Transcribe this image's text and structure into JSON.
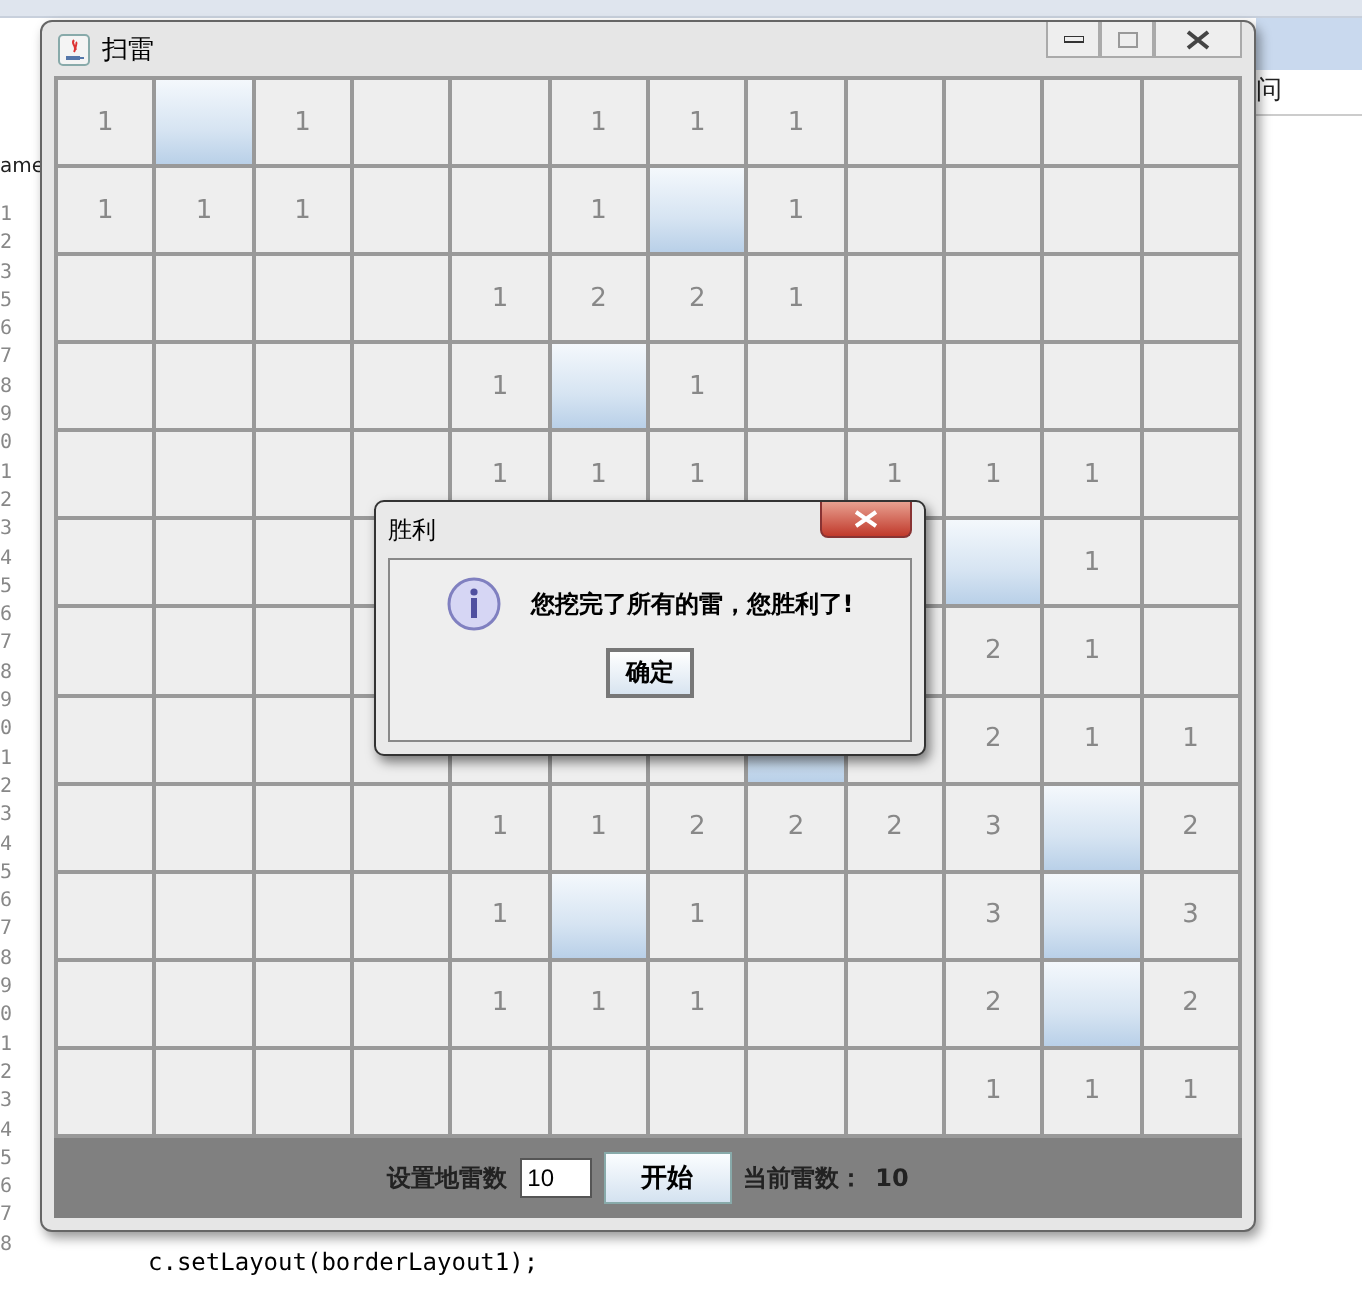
{
  "background": {
    "line_numbers": [
      "1",
      "2",
      "3",
      "5",
      "6",
      "7",
      "8",
      "9",
      "0",
      "1",
      "2",
      "3",
      "4",
      "5",
      "6",
      "7",
      "8",
      "9",
      "0",
      "1",
      "2",
      "3",
      "4",
      "5",
      "6",
      "7",
      "8",
      "9",
      "0",
      "1",
      "2",
      "3",
      "4",
      "5",
      "6",
      "7",
      "8"
    ],
    "side_text": "ame",
    "field_text": "问",
    "code_line": "c.setLayout(borderLayout1);"
  },
  "window": {
    "title": "扫雷",
    "grid": [
      [
        {
          "t": "1",
          "covered": false
        },
        {
          "covered": true
        },
        {
          "t": "1",
          "covered": false
        },
        {
          "covered": false
        },
        {
          "covered": false
        },
        {
          "t": "1",
          "covered": false
        },
        {
          "t": "1",
          "covered": false
        },
        {
          "t": "1",
          "covered": false
        },
        {
          "covered": false
        },
        {
          "covered": false
        },
        {
          "covered": false
        },
        {
          "covered": false
        }
      ],
      [
        {
          "t": "1",
          "covered": false
        },
        {
          "t": "1",
          "covered": false
        },
        {
          "t": "1",
          "covered": false
        },
        {
          "covered": false
        },
        {
          "covered": false
        },
        {
          "t": "1",
          "covered": false
        },
        {
          "covered": true
        },
        {
          "t": "1",
          "covered": false
        },
        {
          "covered": false
        },
        {
          "covered": false
        },
        {
          "covered": false
        },
        {
          "covered": false
        }
      ],
      [
        {
          "covered": false
        },
        {
          "covered": false
        },
        {
          "covered": false
        },
        {
          "covered": false
        },
        {
          "t": "1",
          "covered": false
        },
        {
          "t": "2",
          "covered": false
        },
        {
          "t": "2",
          "covered": false
        },
        {
          "t": "1",
          "covered": false
        },
        {
          "covered": false
        },
        {
          "covered": false
        },
        {
          "covered": false
        },
        {
          "covered": false
        }
      ],
      [
        {
          "covered": false
        },
        {
          "covered": false
        },
        {
          "covered": false
        },
        {
          "covered": false
        },
        {
          "t": "1",
          "covered": false
        },
        {
          "covered": true
        },
        {
          "t": "1",
          "covered": false
        },
        {
          "covered": false
        },
        {
          "covered": false
        },
        {
          "covered": false
        },
        {
          "covered": false
        },
        {
          "covered": false
        }
      ],
      [
        {
          "covered": false
        },
        {
          "covered": false
        },
        {
          "covered": false
        },
        {
          "covered": false
        },
        {
          "t": "1",
          "covered": false
        },
        {
          "t": "1",
          "covered": false
        },
        {
          "t": "1",
          "covered": false
        },
        {
          "covered": false
        },
        {
          "t": "1",
          "covered": false
        },
        {
          "t": "1",
          "covered": false
        },
        {
          "t": "1",
          "covered": false
        },
        {
          "covered": false
        }
      ],
      {
        "cells": [
          {
            "covered": false
          },
          {
            "covered": false
          },
          {
            "covered": false
          },
          {
            "covered": false
          }
        ],
        "cells_right_of_dialog": [
          {
            "covered": false
          },
          {
            "covered": true
          },
          {
            "t": "1",
            "covered": false
          },
          {
            "covered": false
          }
        ]
      },
      {
        "cells": [
          {
            "covered": false
          },
          {
            "covered": false
          },
          {
            "covered": false
          },
          {
            "covered": false
          }
        ],
        "cells_right_of_dialog": [
          {
            "covered": false
          },
          {
            "t": "2",
            "covered": false
          },
          {
            "t": "1",
            "covered": false
          },
          {
            "covered": false
          }
        ]
      },
      [
        {
          "covered": false
        },
        {
          "covered": false
        },
        {
          "covered": false
        },
        {
          "covered": false
        },
        {
          "covered": false
        },
        {
          "covered": false
        },
        {
          "covered": false
        },
        {
          "covered": true
        },
        {
          "covered": false
        },
        {
          "t": "2",
          "covered": false
        },
        {
          "t": "1",
          "covered": false
        },
        {
          "t": "1",
          "covered": false
        }
      ],
      [
        {
          "covered": false
        },
        {
          "covered": false
        },
        {
          "covered": false
        },
        {
          "covered": false
        },
        {
          "t": "1",
          "covered": false
        },
        {
          "t": "1",
          "covered": false
        },
        {
          "t": "2",
          "covered": false
        },
        {
          "t": "2",
          "covered": false
        },
        {
          "t": "2",
          "covered": false
        },
        {
          "t": "3",
          "covered": false
        },
        {
          "covered": true
        },
        {
          "t": "2",
          "covered": false
        }
      ],
      [
        {
          "covered": false
        },
        {
          "covered": false
        },
        {
          "covered": false
        },
        {
          "covered": false
        },
        {
          "t": "1",
          "covered": false
        },
        {
          "covered": true
        },
        {
          "t": "1",
          "covered": false
        },
        {
          "covered": false
        },
        {
          "covered": false
        },
        {
          "t": "3",
          "covered": false
        },
        {
          "covered": true
        },
        {
          "t": "3",
          "covered": false
        }
      ],
      [
        {
          "covered": false
        },
        {
          "covered": false
        },
        {
          "covered": false
        },
        {
          "covered": false
        },
        {
          "t": "1",
          "covered": false
        },
        {
          "t": "1",
          "covered": false
        },
        {
          "t": "1",
          "covered": false
        },
        {
          "covered": false
        },
        {
          "covered": false
        },
        {
          "t": "2",
          "covered": false
        },
        {
          "covered": true
        },
        {
          "t": "2",
          "covered": false
        }
      ],
      [
        {
          "covered": false
        },
        {
          "covered": false
        },
        {
          "covered": false
        },
        {
          "covered": false
        },
        {
          "covered": false
        },
        {
          "covered": false
        },
        {
          "covered": false
        },
        {
          "covered": false
        },
        {
          "covered": false
        },
        {
          "t": "1",
          "covered": false
        },
        {
          "t": "1",
          "covered": false
        },
        {
          "t": "1",
          "covered": false
        }
      ]
    ],
    "bottom_bar": {
      "mine_label": "设置地雷数",
      "mine_input": "10",
      "start_button": "开始",
      "current_label": "当前雷数：",
      "current_value": "10"
    }
  },
  "dialog": {
    "title": "胜利",
    "message": "您挖完了所有的雷，您胜利了!",
    "ok_button": "确定"
  }
}
